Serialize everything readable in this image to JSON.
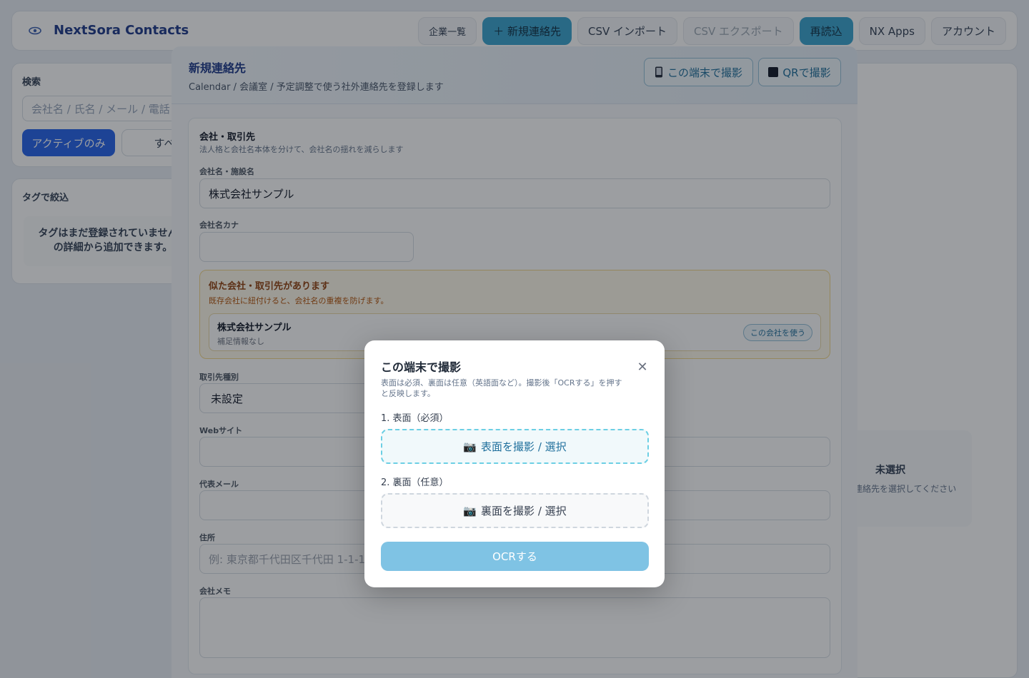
{
  "app": {
    "name": "NextSora Contacts",
    "nav": [
      {
        "label": "企業一覧"
      },
      {
        "label": "＋ 新規連絡先"
      },
      {
        "label": "CSV インポート"
      },
      {
        "label": "CSV エクスポート"
      },
      {
        "label": "再読込"
      },
      {
        "label": "NX Apps"
      },
      {
        "label": "アカウント"
      }
    ]
  },
  "sidebar": {
    "search_title": "検索",
    "search_placeholder": "会社名 / 氏名 / メール / 電話",
    "filter_active": "アクティブのみ",
    "filter_all": "すべ",
    "tags_title": "タグで絞込",
    "tags_empty_line1": "タグはまだ登録されていません。",
    "tags_empty_line2": "の詳細から追加できます。"
  },
  "detail": {
    "empty_title": "未選択",
    "empty_sub": "連絡先を選択してください"
  },
  "modal": {
    "title": "新規連絡先",
    "subtitle": "Calendar / 会議室 / 予定調整で使う社外連絡先を登録します",
    "capture_device": "この端末で撮影",
    "capture_qr": "QRで撮影",
    "section_title": "会社・取引先",
    "section_sub": "法人格と会社名本体を分けて、会社名の揺れを減らします",
    "company_label": "会社名・施設名",
    "company_value": "株式会社サンプル",
    "kana_label": "会社名カナ",
    "kana_value": "",
    "similar_title": "似た会社・取引先があります",
    "similar_sub": "既存会社に紐付けると、会社名の重複を防げます。",
    "similar_name": "株式会社サンプル",
    "similar_meta": "補足情報なし",
    "use_company": "この会社を使う",
    "type_label": "取引先種別",
    "type_value": "未設定",
    "web_label": "Webサイト",
    "email_label": "代表メール",
    "address_label": "住所",
    "address_placeholder": "例: 東京都千代田区千代田 1-1-1",
    "memo_label": "会社メモ"
  },
  "dialog": {
    "title": "この端末で撮影",
    "description": "表面は必須、裏面は任意（英語面など）。撮影後「OCRする」を押すと反映します。",
    "front_label": "1. 表面（必須）",
    "front_button": "表面を撮影 / 選択",
    "back_label": "2. 裏面（任意）",
    "back_button": "裏面を撮影 / 選択",
    "ocr_button": "OCRする"
  },
  "colors": {
    "primary_blue": "#2563eb",
    "accent_teal": "#3aa4cf",
    "brand_navy": "#1e3a8a",
    "warning_bg": "#fffaeb",
    "ocr_button_disabled": "#7fc3e4"
  }
}
